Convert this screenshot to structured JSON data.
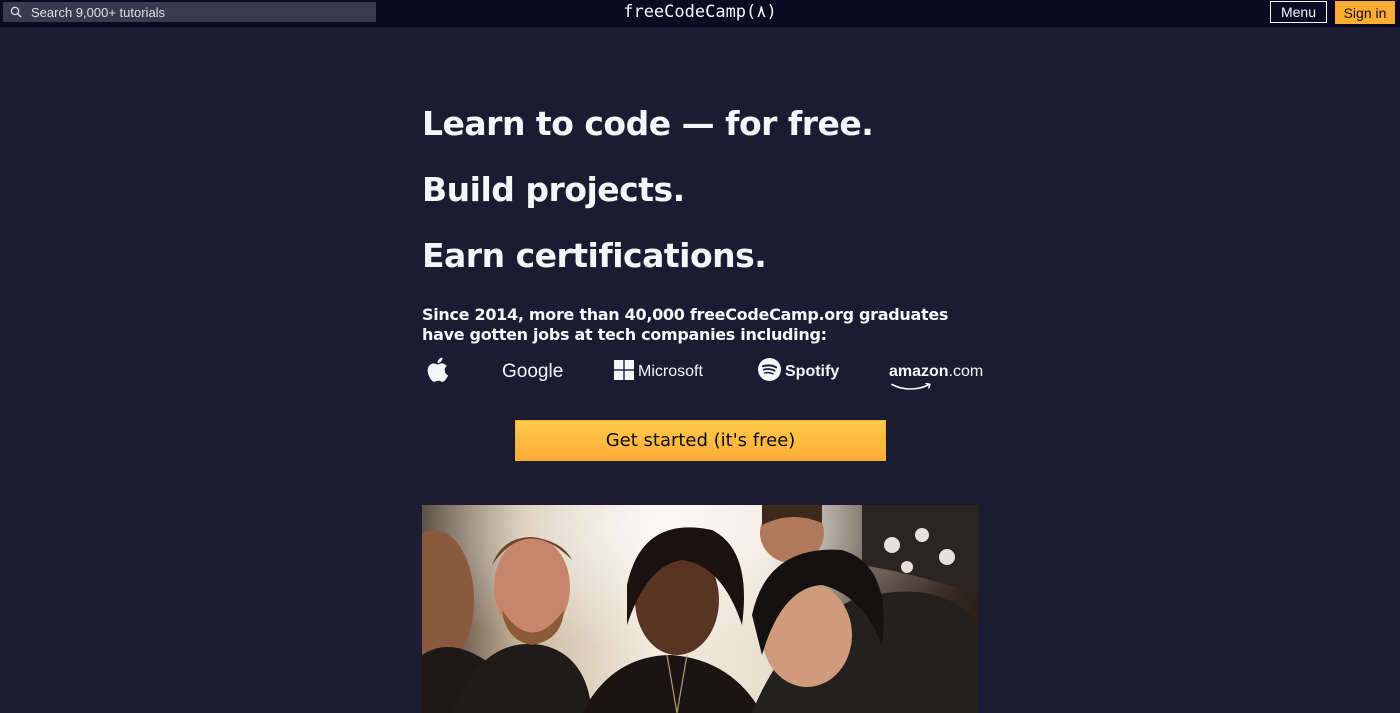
{
  "header": {
    "search_placeholder": "Search 9,000+ tutorials",
    "brand": "freeCodeCamp(٨)",
    "menu_label": "Menu",
    "signin_label": "Sign in"
  },
  "hero": {
    "headlines": [
      "Learn to code — for free.",
      "Build projects.",
      "Earn certifications."
    ],
    "since_text": "Since 2014, more than 40,000 freeCodeCamp.org graduates have gotten jobs at tech companies including:",
    "companies": {
      "apple": "apple-logo",
      "google": "Google",
      "microsoft": "Microsoft",
      "spotify": "Spotify",
      "amazon_main": "amazon",
      "amazon_suffix": ".com"
    },
    "cta_label": "Get started (it's free)"
  },
  "colors": {
    "background": "#1b1b32",
    "topbar": "#0a0a23",
    "search_bg": "#3b3b4f",
    "accent": "#feac32",
    "text": "#f5f6f7"
  },
  "icons": {
    "search": "search-icon",
    "apple": "apple-icon",
    "microsoft": "microsoft-icon",
    "spotify": "spotify-icon",
    "amazon": "amazon-smile-icon"
  }
}
